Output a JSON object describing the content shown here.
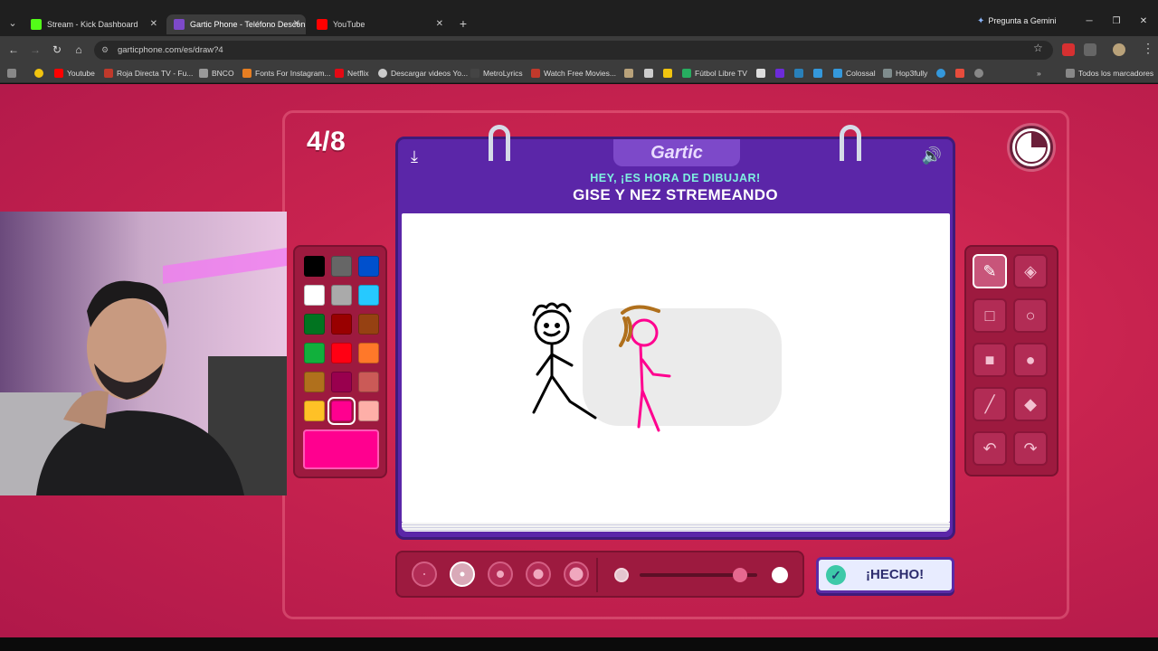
{
  "browser": {
    "tabs": [
      {
        "title": "Stream - Kick Dashboard",
        "favicon_color": "#53fc18",
        "active": false
      },
      {
        "title": "Gartic Phone - Teléfono Descon",
        "favicon_color": "#7d49c9",
        "active": true
      },
      {
        "title": "YouTube",
        "favicon_color": "#ff0000",
        "active": false
      }
    ],
    "gemini_label": "Pregunta a Gemini",
    "url": "garticphone.com/es/draw?4",
    "bookmarks": [
      {
        "label": "Youtube",
        "color": "#ff0000"
      },
      {
        "label": "Roja Directa TV - Fu...",
        "color": "#c0392b"
      },
      {
        "label": "BNCO",
        "color": "#999999"
      },
      {
        "label": "Fonts For Instagram...",
        "color": "#e67e22"
      },
      {
        "label": "Netflix",
        "color": "#e50914"
      },
      {
        "label": "Descargar videos Yo...",
        "color": "#cccccc"
      },
      {
        "label": "MetroLyrics",
        "color": "#444444"
      },
      {
        "label": "Watch Free Movies...",
        "color": "#c0392b"
      },
      {
        "label": "Fútbol Libre TV",
        "color": "#27ae60"
      },
      {
        "label": "Colossal",
        "color": "#3498db"
      },
      {
        "label": "Hop3fully",
        "color": "#7f8c8d"
      }
    ],
    "all_bookmarks_label": "Todos los marcadores"
  },
  "game": {
    "round": "4/8",
    "logo": "Gartic",
    "prompt_sub": "HEY, ¡ES HORA DE DIBUJAR!",
    "prompt_main": "GISE Y NEZ STREMEANDO",
    "done_label": "¡HECHO!",
    "palette": {
      "colors": [
        "#000000",
        "#666666",
        "#0050cd",
        "#ffffff",
        "#aaaaaa",
        "#26c9ff",
        "#017420",
        "#990000",
        "#964112",
        "#11b03c",
        "#ff0013",
        "#ff7829",
        "#b0701c",
        "#99004e",
        "#cb5a57",
        "#ffc126",
        "#ff008f",
        "#feafa8"
      ],
      "selected_index": 16,
      "current_color": "#ff008f"
    },
    "tools": [
      {
        "name": "pencil-tool",
        "icon": "✎",
        "active": true
      },
      {
        "name": "eraser-tool",
        "icon": "◈",
        "active": false
      },
      {
        "name": "square-outline-tool",
        "icon": "□",
        "active": false
      },
      {
        "name": "circle-outline-tool",
        "icon": "○",
        "active": false
      },
      {
        "name": "square-fill-tool",
        "icon": "■",
        "active": false
      },
      {
        "name": "circle-fill-tool",
        "icon": "●",
        "active": false
      },
      {
        "name": "line-tool",
        "icon": "╱",
        "active": false
      },
      {
        "name": "fill-bucket-tool",
        "icon": "◆",
        "active": false
      },
      {
        "name": "undo-tool",
        "icon": "↶",
        "active": false
      },
      {
        "name": "redo-tool",
        "icon": "↷",
        "active": false
      }
    ],
    "brush_sizes": {
      "count": 5,
      "selected_index": 1
    },
    "opacity_level": 0.85
  }
}
